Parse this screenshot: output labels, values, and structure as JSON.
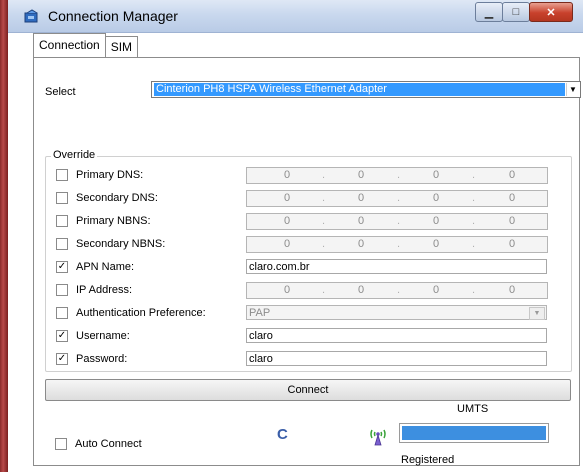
{
  "window": {
    "title": "Connection Manager",
    "minimize_glyph": "▁",
    "maximize_glyph": "□",
    "close_glyph": "✕"
  },
  "tabs": [
    {
      "label": "Connection",
      "active": true
    },
    {
      "label": "SIM",
      "active": false
    }
  ],
  "select": {
    "label": "Select",
    "value": "Cinterion PH8 HSPA Wireless Ethernet Adapter"
  },
  "override": {
    "title": "Override",
    "primary_dns": {
      "label": "Primary DNS:",
      "checked": false,
      "octets": [
        "0",
        "0",
        "0",
        "0"
      ]
    },
    "secondary_dns": {
      "label": "Secondary DNS:",
      "checked": false,
      "octets": [
        "0",
        "0",
        "0",
        "0"
      ]
    },
    "primary_nbns": {
      "label": "Primary NBNS:",
      "checked": false,
      "octets": [
        "0",
        "0",
        "0",
        "0"
      ]
    },
    "secondary_nbns": {
      "label": "Secondary NBNS:",
      "checked": false,
      "octets": [
        "0",
        "0",
        "0",
        "0"
      ]
    },
    "apn": {
      "label": "APN Name:",
      "checked": true,
      "value": "claro.com.br"
    },
    "ip": {
      "label": "IP Address:",
      "checked": false,
      "octets": [
        "0",
        "0",
        "0",
        "0"
      ]
    },
    "auth": {
      "label": "Authentication Preference:",
      "checked": false,
      "value": "PAP"
    },
    "username": {
      "label": "Username:",
      "checked": true,
      "value": "claro"
    },
    "password": {
      "label": "Password:",
      "checked": true,
      "value": "claro"
    }
  },
  "connect_label": "Connect",
  "auto_connect": {
    "label": "Auto Connect",
    "checked": false
  },
  "status": {
    "network_type": "UMTS",
    "state": "Registered",
    "spinner_glyph": "C",
    "signal_level": 1.0,
    "accent": "#3d8fe0"
  },
  "check_mark": "✓"
}
